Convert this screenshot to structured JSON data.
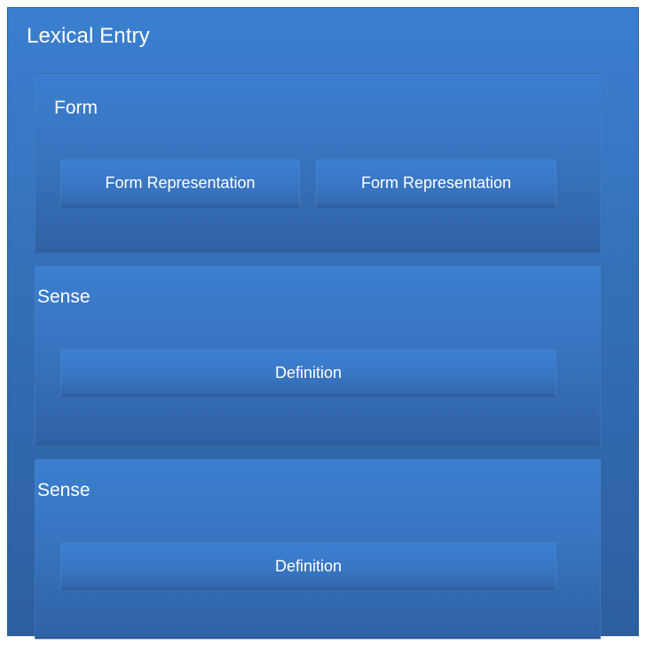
{
  "diagram": {
    "outer": {
      "title": "Lexical Entry"
    },
    "form": {
      "title": "Form",
      "representations": [
        "Form Representation",
        "Form Representation"
      ]
    },
    "senses": [
      {
        "title": "Sense",
        "definition": "Definition"
      },
      {
        "title": "Sense",
        "definition": "Definition"
      }
    ]
  }
}
